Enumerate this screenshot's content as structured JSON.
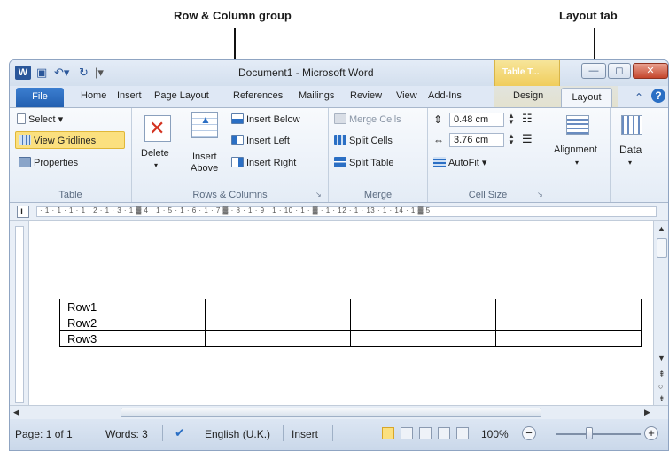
{
  "callouts": {
    "row_column_group": "Row & Column group",
    "layout_tab": "Layout tab"
  },
  "window": {
    "title": "Document1 - Microsoft Word",
    "context_tab": "Table T...",
    "controls": {
      "minimize": "—",
      "maximize": "◻",
      "close": "✕"
    }
  },
  "tabs": {
    "file": "File",
    "items": [
      "Home",
      "Insert",
      "Page Layout",
      "References",
      "Mailings",
      "Review",
      "View",
      "Add-Ins",
      "Design"
    ],
    "active": "Layout"
  },
  "ribbon": {
    "table": {
      "label": "Table",
      "select": "Select ▾",
      "view_gridlines": "View Gridlines",
      "properties": "Properties"
    },
    "rows_columns": {
      "label": "Rows & Columns",
      "delete": "Delete",
      "insert_above_1": "Insert",
      "insert_above_2": "Above",
      "insert_below": "Insert Below",
      "insert_left": "Insert Left",
      "insert_right": "Insert Right"
    },
    "merge": {
      "label": "Merge",
      "merge_cells": "Merge Cells",
      "split_cells": "Split Cells",
      "split_table": "Split Table"
    },
    "cell_size": {
      "label": "Cell Size",
      "height": "0.48 cm",
      "width": "3.76 cm",
      "autofit": "AutoFit ▾"
    },
    "alignment": {
      "label": "Alignment"
    },
    "data": {
      "label": "Data"
    }
  },
  "ruler": {
    "text": "· 1 · 1 · 1 · 1 · 2 · 1 · 3 · 1 ▓ 4 · 1 · 5 · 1 · 6 · 1 · 7 ▓ · 8 · 1 · 9 · 1 · 10 · 1 · ▓ · 1 · 12 · 1 · 13 · 1 · 14 · 1 ▓ 5"
  },
  "document": {
    "rows": [
      [
        "Row1",
        "",
        "",
        ""
      ],
      [
        "Row2",
        "",
        "",
        ""
      ],
      [
        "Row3",
        "",
        "",
        ""
      ]
    ]
  },
  "statusbar": {
    "page": "Page: 1 of 1",
    "words": "Words: 3",
    "language": "English (U.K.)",
    "mode": "Insert",
    "zoom": "100%"
  }
}
